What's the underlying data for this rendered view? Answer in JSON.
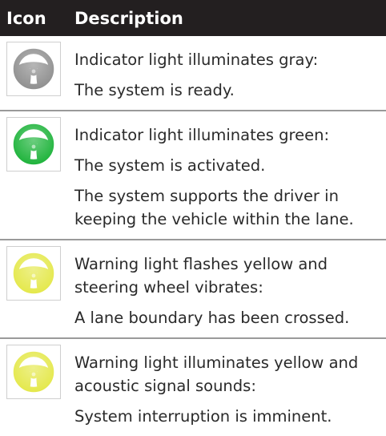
{
  "header": {
    "col_icon": "Icon",
    "col_description": "Description"
  },
  "rows": [
    {
      "icon": "steering-wheel-icon",
      "icon_color": "#8f8f8f",
      "paragraphs": [
        [
          "Indicator light illuminates gray:"
        ],
        [
          "The system is ready."
        ]
      ]
    },
    {
      "icon": "steering-wheel-icon",
      "icon_color": "#1db33a",
      "paragraphs": [
        [
          "Indicator light illuminates green:"
        ],
        [
          "The system is activated."
        ],
        [
          "The system supports the driver in",
          "keeping the vehicle within the lane."
        ]
      ]
    },
    {
      "icon": "steering-wheel-icon",
      "icon_color": "#e4e84a",
      "paragraphs": [
        [
          "Warning light flashes yellow and",
          "steering wheel vibrates:"
        ],
        [
          "A lane boundary has been crossed."
        ]
      ]
    },
    {
      "icon": "steering-wheel-icon",
      "icon_color": "#e4e84a",
      "paragraphs": [
        [
          "Warning light illuminates yellow and",
          "acoustic signal sounds:"
        ],
        [
          "System interruption is imminent."
        ]
      ]
    }
  ]
}
